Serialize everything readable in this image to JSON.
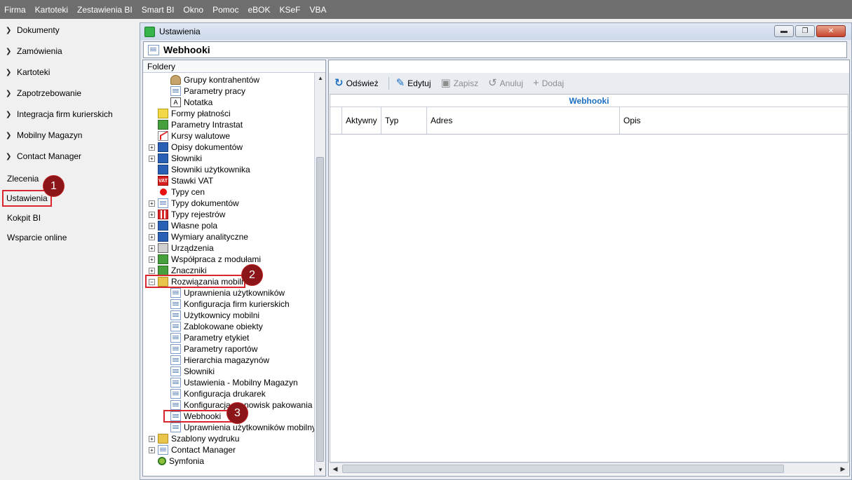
{
  "menubar": [
    "Firma",
    "Kartoteki",
    "Zestawienia BI",
    "Smart BI",
    "Okno",
    "Pomoc",
    "eBOK",
    "KSeF",
    "VBA"
  ],
  "leftnav": {
    "groups": [
      "Dokumenty",
      "Zamówienia",
      "Kartoteki",
      "Zapotrzebowanie",
      "Integracja firm kurierskich",
      "Mobilny Magazyn",
      "Contact Manager"
    ],
    "plain": [
      "Zlecenia",
      "Ustawienia",
      "Kokpit BI",
      "Wsparcie online"
    ],
    "selected": "Ustawienia"
  },
  "badges": [
    "1",
    "2",
    "3"
  ],
  "window": {
    "title": "Ustawienia",
    "header": "Webhooki",
    "folders_label": "Foldery"
  },
  "tree": [
    {
      "label": "Grupy kontrahentów",
      "level": 2,
      "icon": "users-icon"
    },
    {
      "label": "Parametry pracy",
      "level": 2,
      "icon": "page-icon"
    },
    {
      "label": "Notatka",
      "level": 2,
      "icon": "text-icon"
    },
    {
      "label": "Formy płatności",
      "level": 1,
      "icon": "yellow-icon"
    },
    {
      "label": "Parametry Intrastat",
      "level": 1,
      "icon": "green-icon"
    },
    {
      "label": "Kursy walutowe",
      "level": 1,
      "icon": "chart-icon"
    },
    {
      "label": "Opisy dokumentów",
      "level": 1,
      "icon": "blue-icon",
      "expand": "+"
    },
    {
      "label": "Słowniki",
      "level": 1,
      "icon": "blue-icon",
      "expand": "+"
    },
    {
      "label": "Słowniki użytkownika",
      "level": 1,
      "icon": "blue-icon"
    },
    {
      "label": "Stawki VAT",
      "level": 1,
      "icon": "vat-icon"
    },
    {
      "label": "Typy cen",
      "level": 1,
      "icon": "red-dot-icon"
    },
    {
      "label": "Typy dokumentów",
      "level": 1,
      "icon": "page-icon",
      "expand": "+"
    },
    {
      "label": "Typy rejestrów",
      "level": 1,
      "icon": "grid-icon",
      "expand": "+"
    },
    {
      "label": "Własne pola",
      "level": 1,
      "icon": "blue-icon",
      "expand": "+"
    },
    {
      "label": "Wymiary analityczne",
      "level": 1,
      "icon": "blue-icon",
      "expand": "+"
    },
    {
      "label": "Urządzenia",
      "level": 1,
      "icon": "printer-icon",
      "expand": "+"
    },
    {
      "label": "Współpraca z modułami",
      "level": 1,
      "icon": "green-icon",
      "expand": "+"
    },
    {
      "label": "Znaczniki",
      "level": 1,
      "icon": "green-icon",
      "expand": "+"
    },
    {
      "label": "Rozwiązania mobilne",
      "level": 1,
      "icon": "folder-icon",
      "expand": "-"
    },
    {
      "label": "Uprawnienia użytkowników",
      "level": 2,
      "icon": "page-icon"
    },
    {
      "label": "Konfiguracja firm kurierskich",
      "level": 2,
      "icon": "page-icon"
    },
    {
      "label": "Użytkownicy mobilni",
      "level": 2,
      "icon": "page-icon"
    },
    {
      "label": "Zablokowane obiekty",
      "level": 2,
      "icon": "page-icon"
    },
    {
      "label": "Parametry etykiet",
      "level": 2,
      "icon": "page-icon"
    },
    {
      "label": "Parametry raportów",
      "level": 2,
      "icon": "page-icon"
    },
    {
      "label": "Hierarchia magazynów",
      "level": 2,
      "icon": "page-icon"
    },
    {
      "label": "Słowniki",
      "level": 2,
      "icon": "page-icon"
    },
    {
      "label": "Ustawienia - Mobilny Magazyn",
      "level": 2,
      "icon": "page-icon"
    },
    {
      "label": "Konfiguracja drukarek",
      "level": 2,
      "icon": "page-icon"
    },
    {
      "label": "Konfiguracja stanowisk pakowania",
      "level": 2,
      "icon": "page-icon"
    },
    {
      "label": "Webhooki",
      "level": 2,
      "icon": "page-icon"
    },
    {
      "label": "Uprawnienia użytkowników mobilnych",
      "level": 2,
      "icon": "page-icon"
    },
    {
      "label": "Szablony wydruku",
      "level": 1,
      "icon": "folder-icon",
      "expand": "+"
    },
    {
      "label": "Contact Manager",
      "level": 1,
      "icon": "page-icon",
      "expand": "+"
    },
    {
      "label": "Symfonia",
      "level": 1,
      "icon": "symf-icon"
    }
  ],
  "toolbar": {
    "refresh": "Odśwież",
    "edit": "Edytuj",
    "save": "Zapisz",
    "cancel": "Anuluj",
    "add": "Dodaj"
  },
  "grid": {
    "title": "Webhooki",
    "columns": [
      "Aktywny",
      "Typ",
      "Adres",
      "Opis"
    ]
  },
  "colors": {
    "accent": "#1b6fc4",
    "highlight": "#d9262e",
    "badge": "#8b1518"
  }
}
